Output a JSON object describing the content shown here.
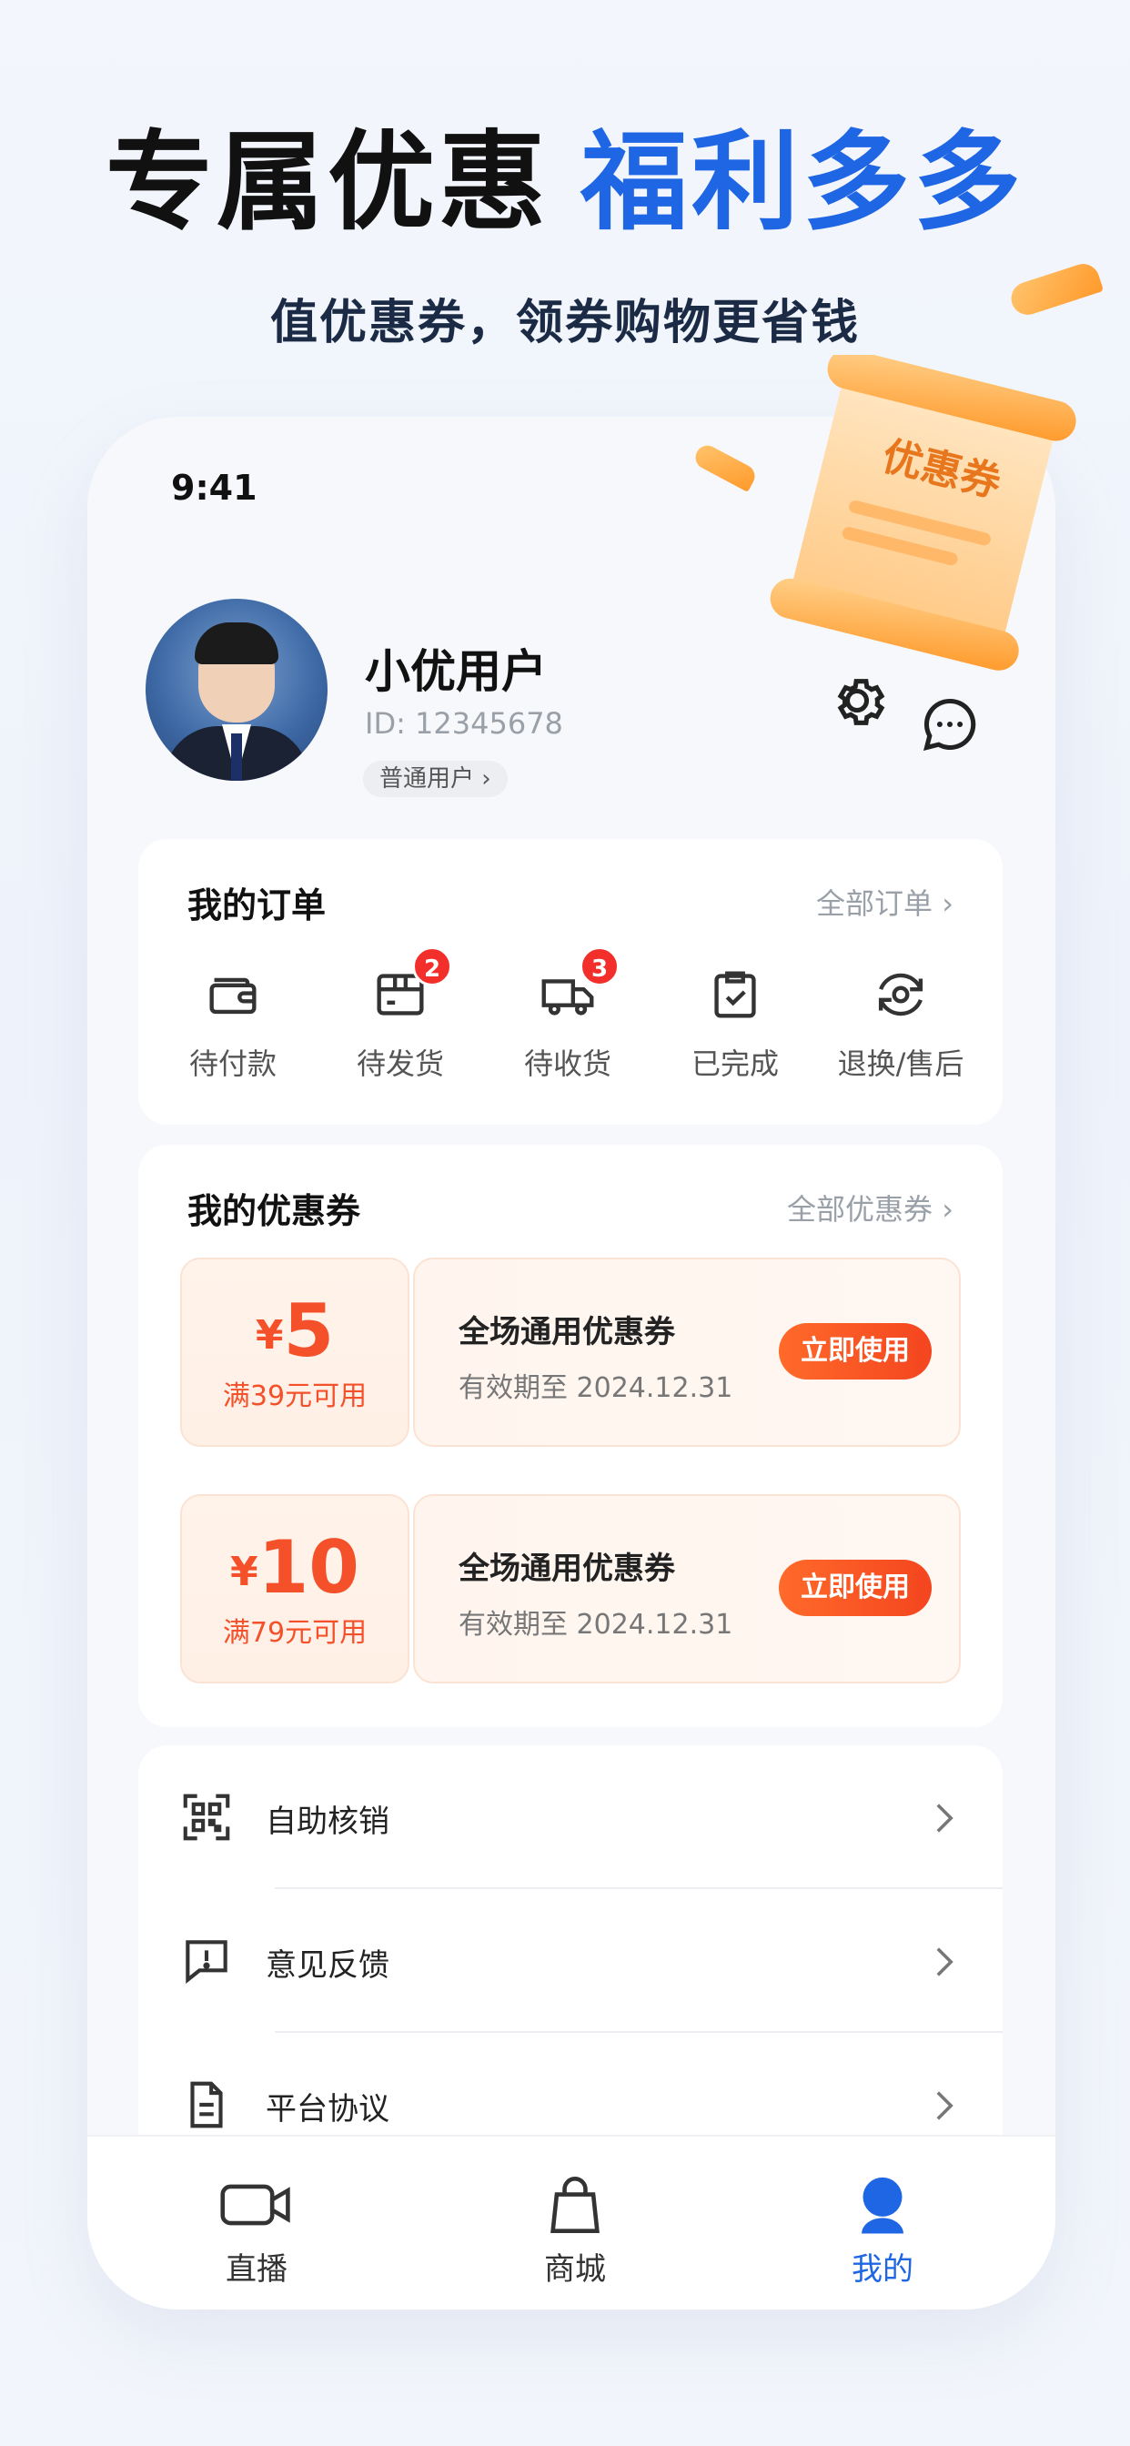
{
  "promo": {
    "title_part1": "专属优惠",
    "title_part2": "福利多多",
    "subtitle": "值优惠券，领券购物更省钱"
  },
  "status_bar": {
    "time": "9:41"
  },
  "decor": {
    "coupon_scroll_label": "优惠券"
  },
  "profile": {
    "name": "小优用户",
    "id": "ID: 12345678",
    "level": "普通用户 ›"
  },
  "orders": {
    "title": "我的订单",
    "all_link": "全部订单 ›",
    "items": [
      {
        "label": "待付款",
        "icon": "wallet-icon",
        "badge": null
      },
      {
        "label": "待发货",
        "icon": "package-box-icon",
        "badge": "2"
      },
      {
        "label": "待收货",
        "icon": "delivery-truck-icon",
        "badge": "3"
      },
      {
        "label": "已完成",
        "icon": "clipboard-check-icon",
        "badge": null
      },
      {
        "label": "退换/售后",
        "icon": "return-exchange-icon",
        "badge": null
      }
    ]
  },
  "coupons": {
    "title": "我的优惠券",
    "all_link": "全部优惠券 ›",
    "items": [
      {
        "currency": "¥",
        "amount": "5",
        "condition": "满39元可用",
        "name": "全场通用优惠券",
        "expiry": "有效期至 2024.12.31",
        "button": "立即使用"
      },
      {
        "currency": "¥",
        "amount": "10",
        "condition": "满79元可用",
        "name": "全场通用优惠券",
        "expiry": "有效期至 2024.12.31",
        "button": "立即使用"
      }
    ]
  },
  "menu": [
    {
      "label": "自助核销",
      "icon": "qr-scan-icon"
    },
    {
      "label": "意见反馈",
      "icon": "feedback-icon"
    },
    {
      "label": "平台协议",
      "icon": "document-icon"
    }
  ],
  "tabbar": [
    {
      "label": "直播",
      "icon": "video-camera-icon",
      "active": false
    },
    {
      "label": "商城",
      "icon": "shopping-bag-icon",
      "active": false
    },
    {
      "label": "我的",
      "icon": "user-icon",
      "active": true
    }
  ],
  "colors": {
    "accent_blue": "#1f66e5",
    "coupon_orange": "#f4512b",
    "badge_red": "#f22f2a",
    "scroll_orange": "#ff9a2b"
  }
}
